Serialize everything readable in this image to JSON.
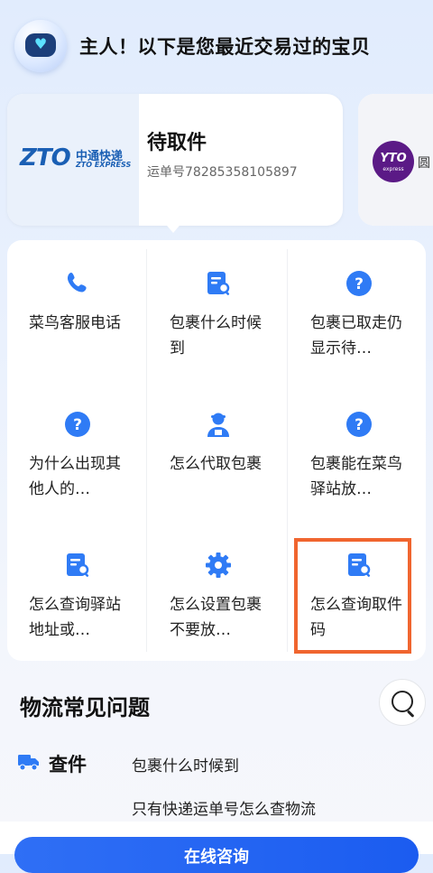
{
  "header": {
    "greeting": "主人！以下是您最近交易过的宝贝"
  },
  "package": {
    "carrier_cn": "中通快递",
    "carrier_en": "ZTO EXPRESS",
    "carrier_mark": "ZTO",
    "status": "待取件",
    "waybill": "运单号78285358105897"
  },
  "package2": {
    "carrier_mark": "YTO",
    "carrier_sub": "express",
    "label_partial": "圆"
  },
  "menu": {
    "items": [
      {
        "label": "菜鸟客服电话",
        "icon": "phone-icon"
      },
      {
        "label": "包裹什么时候到",
        "icon": "document-search-icon"
      },
      {
        "label": "包裹已取走仍显示待…",
        "icon": "question-icon"
      },
      {
        "label": "为什么出现其他人的…",
        "icon": "question-icon"
      },
      {
        "label": "怎么代取包裹",
        "icon": "courier-icon"
      },
      {
        "label": "包裹能在菜鸟驿站放…",
        "icon": "question-icon"
      },
      {
        "label": "怎么查询驿站地址或…",
        "icon": "document-search-icon"
      },
      {
        "label": "怎么设置包裹不要放…",
        "icon": "gear-icon"
      },
      {
        "label": "怎么查询取件码",
        "icon": "document-search-icon"
      }
    ]
  },
  "faq": {
    "title": "物流常见问题",
    "category": "查件",
    "questions": [
      "包裹什么时候到",
      "只有快递运单号怎么查物流"
    ]
  },
  "cta": {
    "label": "在线咨询"
  },
  "colors": {
    "accent": "#2f6ff5",
    "icon_blue": "#2f7bf5",
    "highlight": "#f0652f",
    "zto_blue": "#1a5fb4",
    "yto_purple": "#5b1a86"
  }
}
